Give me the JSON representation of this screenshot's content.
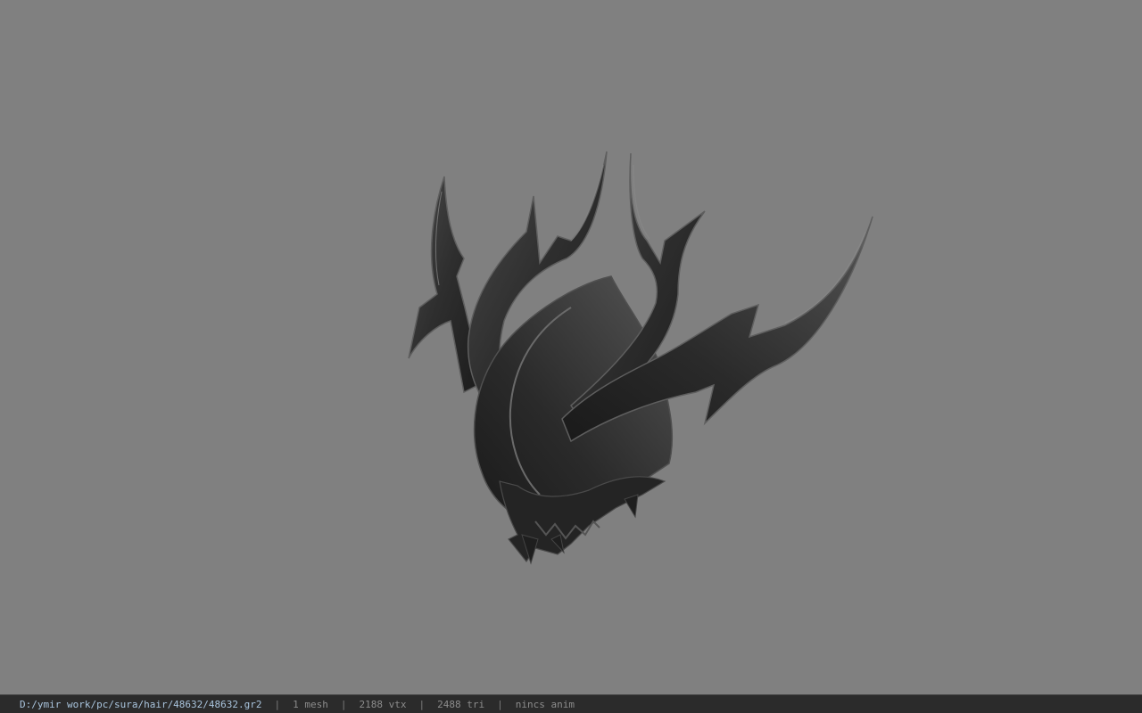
{
  "viewer": {
    "background_color": "#808080",
    "model": {
      "icon": "spiked-helmet-model",
      "base_color": "#2f2f2f",
      "edge_color": "#5a5a5a",
      "highlight_color": "#8a8a8a"
    }
  },
  "statusbar": {
    "file_path": "D:/ymir work/pc/sura/hair/48632/48632.gr2",
    "separator": "|",
    "mesh_count": "1 mesh",
    "vertex_count": "2188 vtx",
    "triangle_count": "2488 tri",
    "anim_status": "nincs anim"
  }
}
